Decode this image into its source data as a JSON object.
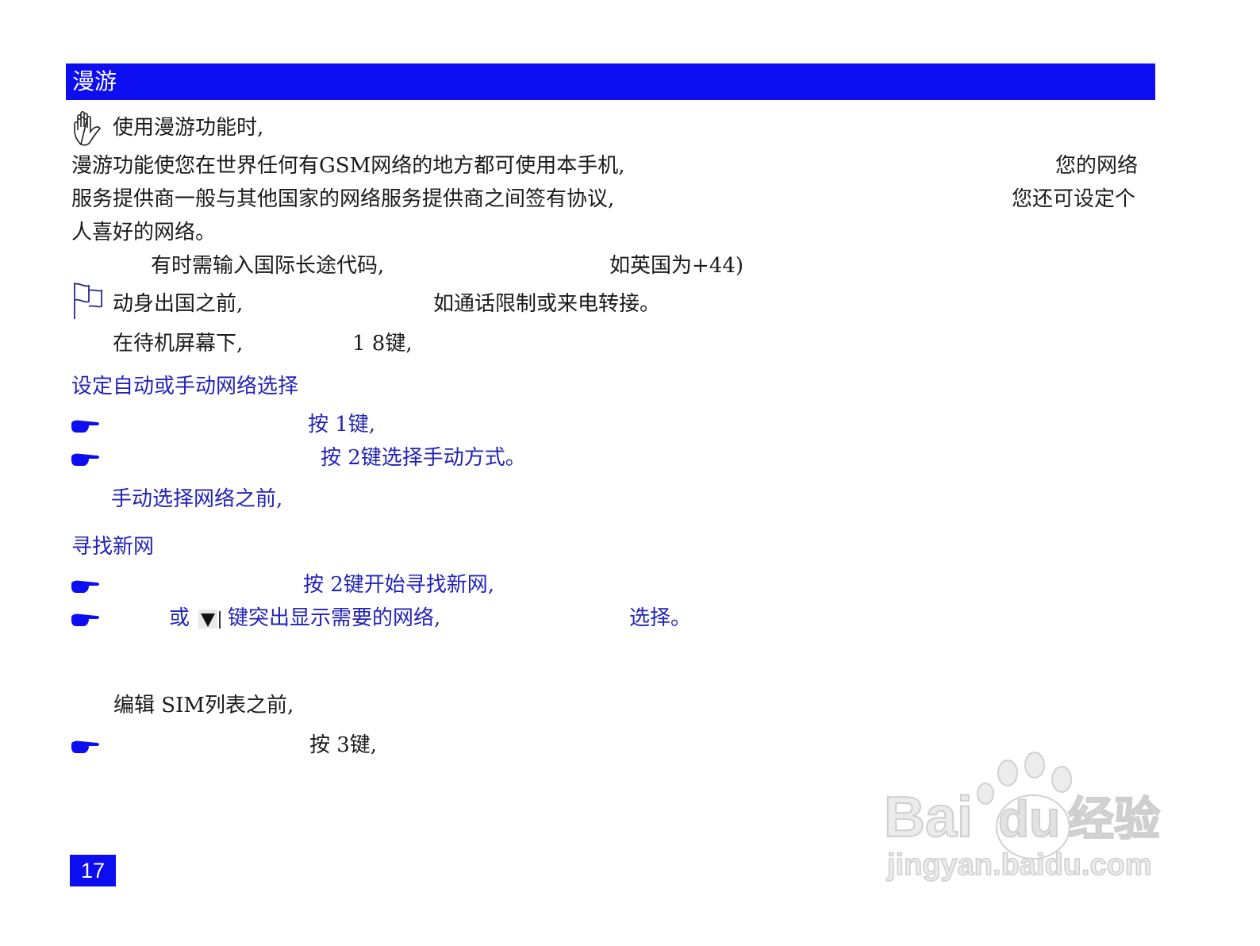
{
  "header": {
    "title": "漫游"
  },
  "intro": {
    "note_label": "使用漫游功能时,",
    "line1_left": "漫游功能使您在世界任何有GSM网络的地方都可使用本手机,",
    "line1_right": "您的网络",
    "line2_left": "服务提供商一般与其他国家的网络服务提供商之间签有协议,",
    "line2_right": "您还可设定个",
    "line3": "人喜好的网络。",
    "intl_left": "有时需输入国际长途代码,",
    "intl_right": "如英国为+44)",
    "depart_left": "动身出国之前,",
    "depart_right": "如通话限制或来电转接。",
    "standby_left": "在待机屏幕下,",
    "standby_right": "1 8键,"
  },
  "section_auto": {
    "title": "设定自动或手动网络选择",
    "step1": "按 1键,",
    "step2": "按 2键选择手动方式。",
    "note": "手动选择网络之前,"
  },
  "section_search": {
    "title": "寻找新网",
    "step1": "按 2键开始寻找新网,",
    "step2_a": "或",
    "step2_b": "键突出显示需要的网络,",
    "step2_c": "选择。"
  },
  "section_sim": {
    "note": "编辑 SIM列表之前,",
    "step1": "按 3键,"
  },
  "page_number": "17",
  "watermark": {
    "brand": "Bai",
    "brand_tail": "du",
    "cn": "经验",
    "url": "jingyan.baidu.com"
  },
  "colors": {
    "accent_blue": "#0d0df2",
    "text_blue": "#2323b8"
  },
  "icons": [
    "raised-hand-icon",
    "flag-icon",
    "pointing-hand-icon",
    "down-arrow-key-icon",
    "paw-icon"
  ]
}
